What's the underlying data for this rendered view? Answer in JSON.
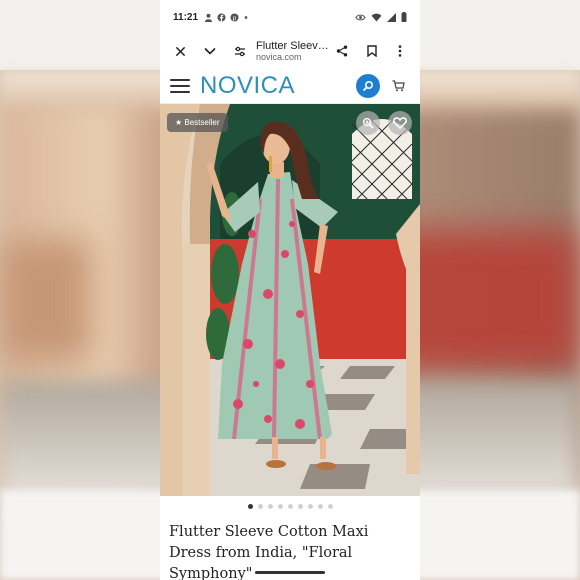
{
  "status_bar": {
    "time": "11:21",
    "left_icons": [
      "account-icon",
      "facebook-icon",
      "pinterest-icon",
      "dot-icon"
    ],
    "right_icons": [
      "eye-icon",
      "wifi-icon",
      "signal-icon",
      "battery-icon"
    ]
  },
  "browser": {
    "page_title": "Flutter Sleeve C...",
    "domain": "novica.com",
    "buttons": [
      "close-icon",
      "chevron-down-icon",
      "tune-icon",
      "share-icon",
      "bookmark-icon",
      "more-icon"
    ]
  },
  "site": {
    "logo": "NOVICA",
    "colors": {
      "logo": "#2e8fb8",
      "search_button": "#1e7fd1"
    }
  },
  "product": {
    "badge": "★ Bestseller",
    "carousel": {
      "count": 9,
      "active_index": 0
    },
    "title": "Flutter Sleeve Cotton Maxi Dress from India, \"Floral Symphony\""
  }
}
